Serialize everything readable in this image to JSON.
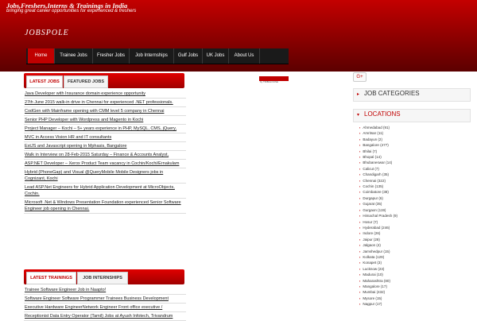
{
  "site": {
    "title": "Jobs,Freshers,Interns & Trainings in India",
    "tagline": "bringing great career opportunities for experienced & freshers",
    "logo": "JOBSPOLE"
  },
  "nav": {
    "items": [
      "Home",
      "Trainee Jobs",
      "Fresher Jobs",
      "Job Internships",
      "Gulf Jobs",
      "UK Jobs",
      "About Us"
    ],
    "active": "Home"
  },
  "panel1": {
    "tabs": [
      "LATEST JOBS",
      "FEATURED JOBS"
    ],
    "items": [
      "Java Developer with Insurance domain experience opportunity",
      "27th June 2015 walk-in drive in Chennai for experienced .NET professionals.",
      "CodGen with Mainframe opening with CMM level 5 company in Chennai",
      "Senior PHP Developer with Wordpress and Magento in Kochi",
      "Project Manager – Kochi – 5+ years experience in PHP, MySQL, CMS, jQuery,",
      "MVC in Access Vision HR and IT consultants",
      "ExtJS and Javascript opening in Mphasis, Bangalore",
      "Walk in Interview on 28-Feb-2015 Saturday – Finance & Accounts Analyst,",
      "ASP.NET Developer – Xerox Product Team vacancy in Cochin/Kochi/Ernakulam",
      "Hybrid (PhoneGap) and Visual @QueryMobile Mobile Designers jobs in Cognizant, Kochi",
      "Lead ASP.Net Engineers for Hybrid Application Development at MicroObjects, Cochin.",
      "Microsoft .Net & Windows Presentation Foundation experienced Senior Software Engineer job opening in Chennai."
    ]
  },
  "panel2": {
    "tabs": [
      "LATEST TRAININGS",
      "JOB INTERNSHIPS"
    ],
    "items": [
      "Trainee Software Engineer Job in Naapto!",
      "Software Engineer Software Programmer Trainees Business Development",
      "Executive Hardware EngineerNetwork Engineer Front office executive /",
      "Receptionist Data Entry Operator (Tamil) Jobs at Ayush Infotech, Trivandrum"
    ]
  },
  "middle": {
    "text": "by TRIBALOUSE"
  },
  "sidebar": {
    "gplus": "G+",
    "categories_title": "JOB CATEGORIES",
    "locations_title": "LOCATIONS",
    "locations": [
      "Ahmedabad (91)",
      "Amritsar (11)",
      "Badayun (2)",
      "Bangalore (477)",
      "Bhilai (7)",
      "Bhopal (14)",
      "Bhubaneswar (14)",
      "Calicut (7)",
      "Chandigarh (35)",
      "Chennai (322)",
      "Cochin (135)",
      "Coimbatore (38)",
      "Durgapur (6)",
      "Gujarat (35)",
      "Gurgaon (119)",
      "Himachal Pradesh (9)",
      "Hosur (7)",
      "Hyderabad (246)",
      "Indore (26)",
      "Jaipur (28)",
      "Jalgaon (4)",
      "Jamshedpur (15)",
      "Kolkata (129)",
      "Konapet (3)",
      "Lucknow (23)",
      "Madurai (10)",
      "Maharashtra (80)",
      "Mangalore (17)",
      "Mumbai (432)",
      "Mysore (15)",
      "Nagpur (17)"
    ]
  }
}
